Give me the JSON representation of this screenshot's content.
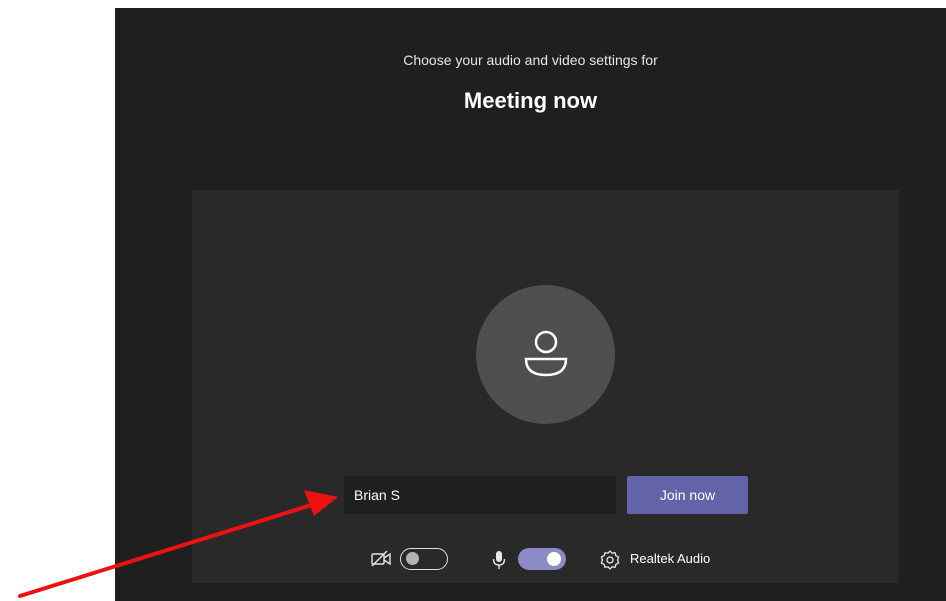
{
  "header": {
    "subtitle": "Choose your audio and video settings for",
    "meeting_title": "Meeting now"
  },
  "join": {
    "name_value": "Brian S",
    "join_label": "Join now"
  },
  "controls": {
    "camera": {
      "icon": "camera-off-icon",
      "on": false
    },
    "microphone": {
      "icon": "microphone-icon",
      "on": true
    },
    "device_settings_icon": "gear-icon",
    "audio_device": "Realtek Audio"
  },
  "colors": {
    "background": "#1f1f1f",
    "preview": "#292929",
    "avatar": "#4f4f4f",
    "accent": "#6264a7",
    "toggle_on": "#8b8cc7",
    "annotation_arrow": "#ee1111"
  }
}
